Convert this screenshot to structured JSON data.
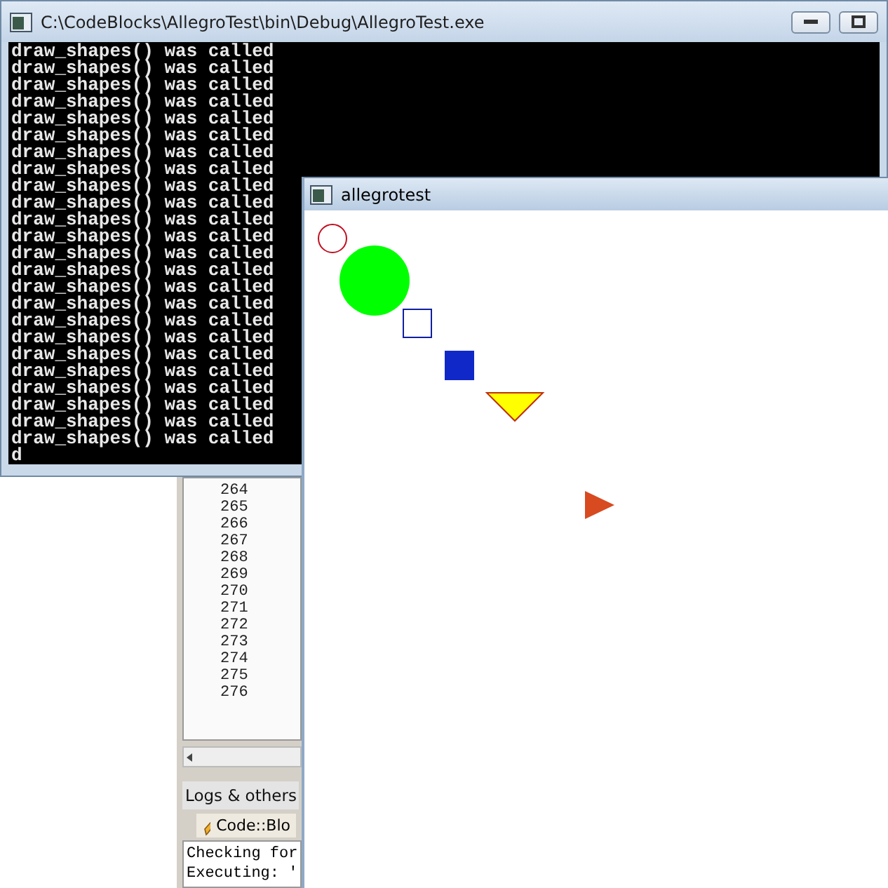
{
  "console_window": {
    "title": "C:\\CodeBlocks\\AllegroTest\\bin\\Debug\\AllegroTest.exe",
    "lines": [
      "draw_shapes() was called",
      "draw_shapes() was called",
      "draw_shapes() was called",
      "draw_shapes() was called",
      "draw_shapes() was called",
      "draw_shapes() was called",
      "draw_shapes() was called",
      "draw_shapes() was called",
      "draw_shapes() was called",
      "draw_shapes() was called",
      "draw_shapes() was called",
      "draw_shapes() was called",
      "draw_shapes() was called",
      "draw_shapes() was called",
      "draw_shapes() was called",
      "draw_shapes() was called",
      "draw_shapes() was called",
      "draw_shapes() was called",
      "draw_shapes() was called",
      "draw_shapes() was called",
      "draw_shapes() was called",
      "draw_shapes() was called",
      "draw_shapes() was called",
      "draw_shapes() was called",
      "d"
    ]
  },
  "editor": {
    "line_numbers": [
      "264",
      "265",
      "266",
      "267",
      "268",
      "269",
      "270",
      "271",
      "272",
      "273",
      "274",
      "275",
      "276"
    ]
  },
  "logs_panel": {
    "title": "Logs & others",
    "tab": "Code::Blo",
    "lines": [
      "Checking for",
      "Executing: '"
    ]
  },
  "allegro_window": {
    "title": "allegrotest"
  }
}
